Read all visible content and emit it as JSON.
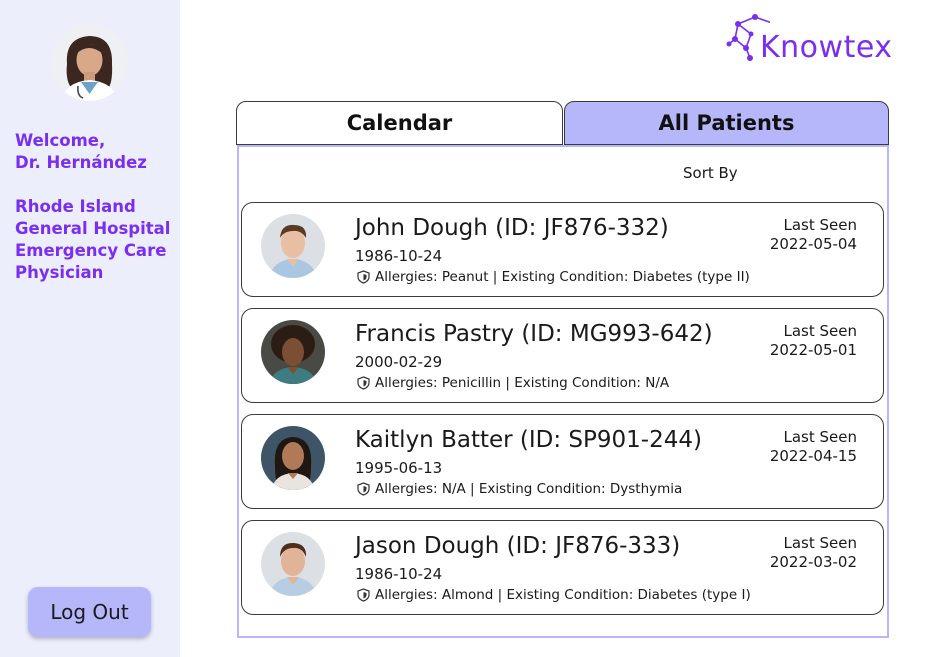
{
  "sidebar": {
    "welcome_line1": "Welcome,",
    "welcome_line2": "Dr. Hernández",
    "affiliation": [
      "Rhode Island",
      "General Hospital",
      "Emergency Care",
      "Physician"
    ],
    "logout_label": "Log Out"
  },
  "logo": {
    "text": "Knowtex"
  },
  "tabs": [
    {
      "label": "Calendar",
      "active": false
    },
    {
      "label": "All Patients",
      "active": true
    }
  ],
  "sort_label": "Sort By",
  "last_seen_label": "Last Seen",
  "patients": [
    {
      "name": "John Dough (ID: JF876-332)",
      "dob": "1986-10-24",
      "info": "Allergies: Peanut | Existing Condition: Diabetes (type II)",
      "last_seen": "2022-05-04"
    },
    {
      "name": "Francis Pastry (ID: MG993-642)",
      "dob": "2000-02-29",
      "info": "Allergies: Penicillin | Existing Condition: N/A",
      "last_seen": "2022-05-01"
    },
    {
      "name": "Kaitlyn Batter (ID: SP901-244)",
      "dob": "1995-06-13",
      "info": "Allergies: N/A | Existing Condition: Dysthymia",
      "last_seen": "2022-04-15"
    },
    {
      "name": "Jason Dough (ID: JF876-333)",
      "dob": "1986-10-24",
      "info": "Allergies: Almond | Existing Condition: Diabetes (type I)",
      "last_seen": "2022-03-02"
    }
  ],
  "colors": {
    "accent": "#7a2ef0",
    "active_tab": "#b6b7fb",
    "sidebar_bg": "#eceefb"
  }
}
